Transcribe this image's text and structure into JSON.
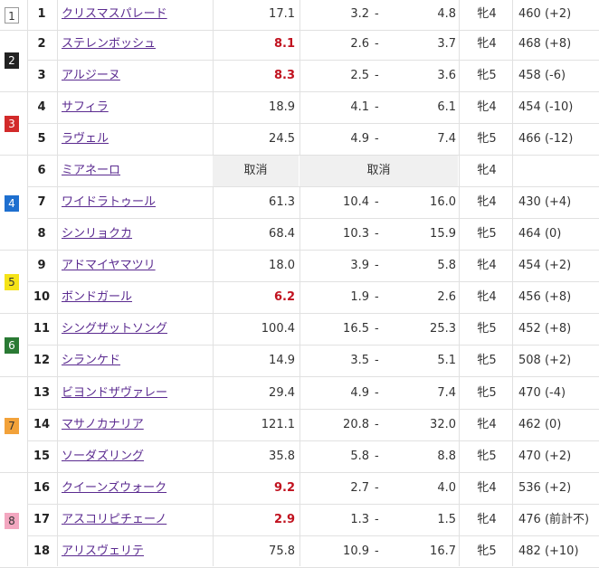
{
  "colors": {
    "favorite_odds": "#c1121f",
    "horse_link": "#5b2b90",
    "waku": [
      "#ffffff",
      "#222222",
      "#d22a2a",
      "#1e6fcf",
      "#f5e318",
      "#2a7a34",
      "#f2a23a",
      "#f3a7c0"
    ],
    "waku_text": [
      "#333333",
      "#ffffff",
      "#ffffff",
      "#ffffff",
      "#333333",
      "#ffffff",
      "#333333",
      "#333333"
    ]
  },
  "waku": [
    {
      "label": "1"
    },
    {
      "label": "2"
    },
    {
      "label": "3"
    },
    {
      "label": "4"
    },
    {
      "label": "5"
    },
    {
      "label": "6"
    },
    {
      "label": "7"
    },
    {
      "label": "8"
    }
  ],
  "horses": [
    {
      "num": "1",
      "name": "クリスマスパレード",
      "odds": "17.1",
      "place_min": "3.2",
      "sep": "-",
      "place_max": "4.8",
      "sex_age": "牝4",
      "weight": "460 (+2)"
    },
    {
      "num": "2",
      "name": "ステレンボッシュ",
      "odds": "8.1",
      "place_min": "2.6",
      "sep": "-",
      "place_max": "3.7",
      "sex_age": "牝4",
      "weight": "468 (+8)"
    },
    {
      "num": "3",
      "name": "アルジーヌ",
      "odds": "8.3",
      "place_min": "2.5",
      "sep": "-",
      "place_max": "3.6",
      "sex_age": "牝5",
      "weight": "458 (-6)"
    },
    {
      "num": "4",
      "name": "サフィラ",
      "odds": "18.9",
      "place_min": "4.1",
      "sep": "-",
      "place_max": "6.1",
      "sex_age": "牝4",
      "weight": "454 (-10)"
    },
    {
      "num": "5",
      "name": "ラヴェル",
      "odds": "24.5",
      "place_min": "4.9",
      "sep": "-",
      "place_max": "7.4",
      "sex_age": "牝5",
      "weight": "466 (-12)"
    },
    {
      "num": "6",
      "name": "ミアネーロ",
      "cancel_odds": "取消",
      "cancel_place": "取消",
      "sex_age": "牝4",
      "weight": ""
    },
    {
      "num": "7",
      "name": "ワイドラトゥール",
      "odds": "61.3",
      "place_min": "10.4",
      "sep": "-",
      "place_max": "16.0",
      "sex_age": "牝4",
      "weight": "430 (+4)"
    },
    {
      "num": "8",
      "name": "シンリョクカ",
      "odds": "68.4",
      "place_min": "10.3",
      "sep": "-",
      "place_max": "15.9",
      "sex_age": "牝5",
      "weight": "464 (0)"
    },
    {
      "num": "9",
      "name": "アドマイヤマツリ",
      "odds": "18.0",
      "place_min": "3.9",
      "sep": "-",
      "place_max": "5.8",
      "sex_age": "牝4",
      "weight": "454 (+2)"
    },
    {
      "num": "10",
      "name": "ボンドガール",
      "odds": "6.2",
      "place_min": "1.9",
      "sep": "-",
      "place_max": "2.6",
      "sex_age": "牝4",
      "weight": "456 (+8)"
    },
    {
      "num": "11",
      "name": "シングザットソング",
      "odds": "100.4",
      "place_min": "16.5",
      "sep": "-",
      "place_max": "25.3",
      "sex_age": "牝5",
      "weight": "452 (+8)"
    },
    {
      "num": "12",
      "name": "シランケド",
      "odds": "14.9",
      "place_min": "3.5",
      "sep": "-",
      "place_max": "5.1",
      "sex_age": "牝5",
      "weight": "508 (+2)"
    },
    {
      "num": "13",
      "name": "ビヨンドザヴァレー",
      "odds": "29.4",
      "place_min": "4.9",
      "sep": "-",
      "place_max": "7.4",
      "sex_age": "牝5",
      "weight": "470 (-4)"
    },
    {
      "num": "14",
      "name": "マサノカナリア",
      "odds": "121.1",
      "place_min": "20.8",
      "sep": "-",
      "place_max": "32.0",
      "sex_age": "牝4",
      "weight": "462 (0)"
    },
    {
      "num": "15",
      "name": "ソーダズリング",
      "odds": "35.8",
      "place_min": "5.8",
      "sep": "-",
      "place_max": "8.8",
      "sex_age": "牝5",
      "weight": "470 (+2)"
    },
    {
      "num": "16",
      "name": "クイーンズウォーク",
      "odds": "9.2",
      "place_min": "2.7",
      "sep": "-",
      "place_max": "4.0",
      "sex_age": "牝4",
      "weight": "536 (+2)"
    },
    {
      "num": "17",
      "name": "アスコリピチェーノ",
      "odds": "2.9",
      "place_min": "1.3",
      "sep": "-",
      "place_max": "1.5",
      "sex_age": "牝4",
      "weight": "476 (前計不)"
    },
    {
      "num": "18",
      "name": "アリスヴェリテ",
      "odds": "75.8",
      "place_min": "10.9",
      "sep": "-",
      "place_max": "16.7",
      "sex_age": "牝5",
      "weight": "482 (+10)"
    }
  ],
  "favorite_rows": [
    2,
    3,
    10,
    16,
    17
  ]
}
